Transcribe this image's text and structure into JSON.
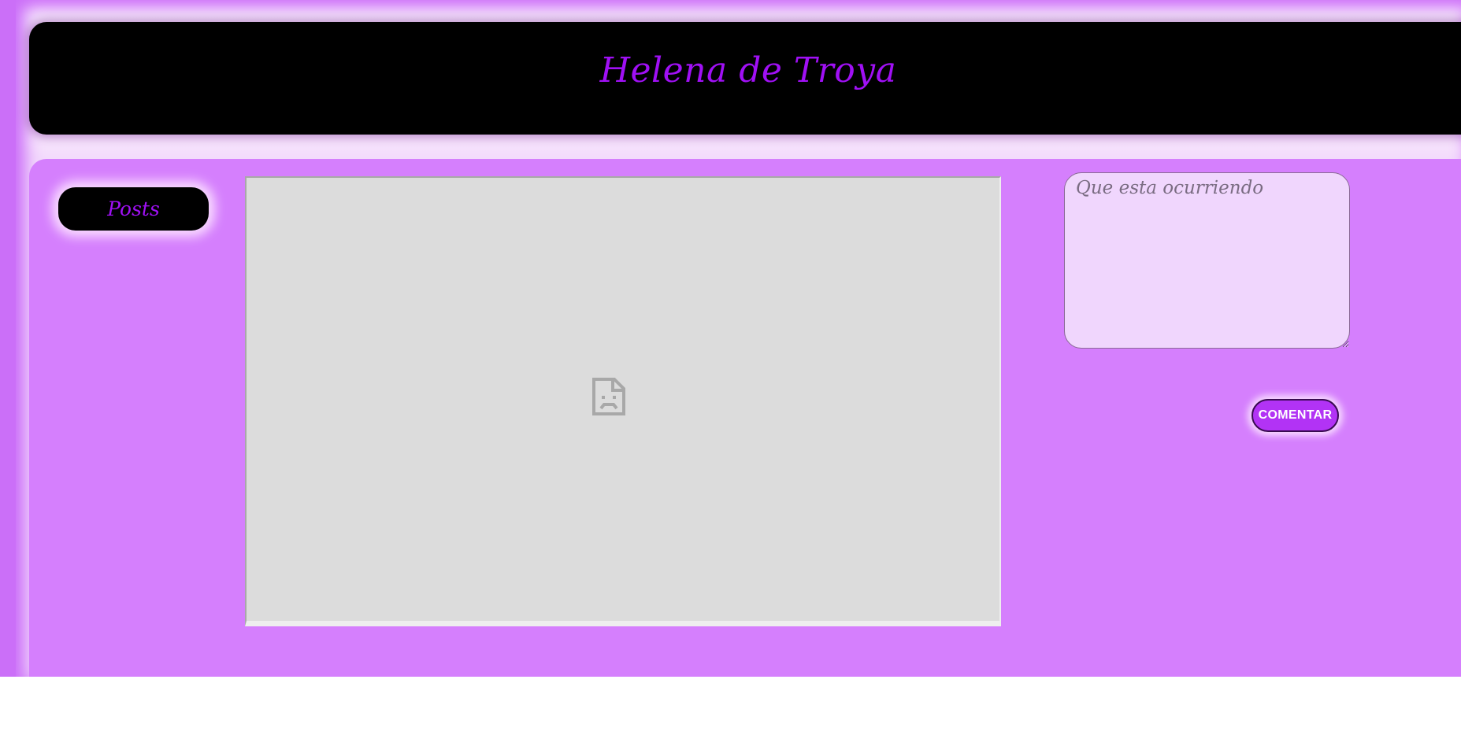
{
  "header": {
    "title": "Helena de Troya"
  },
  "sidebar": {
    "posts_label": "Posts"
  },
  "media": {
    "icon": "broken-image-icon"
  },
  "composer": {
    "placeholder": "Que esta ocurriendo",
    "value": "",
    "submit_label": "COMENTAR"
  },
  "colors": {
    "page_background": "#cb6ff8",
    "panel_background": "#d57ffd",
    "header_background": "#000000",
    "title_color": "#a010f5",
    "button_color": "#b233f5",
    "textarea_background": "#f0d6fd"
  }
}
